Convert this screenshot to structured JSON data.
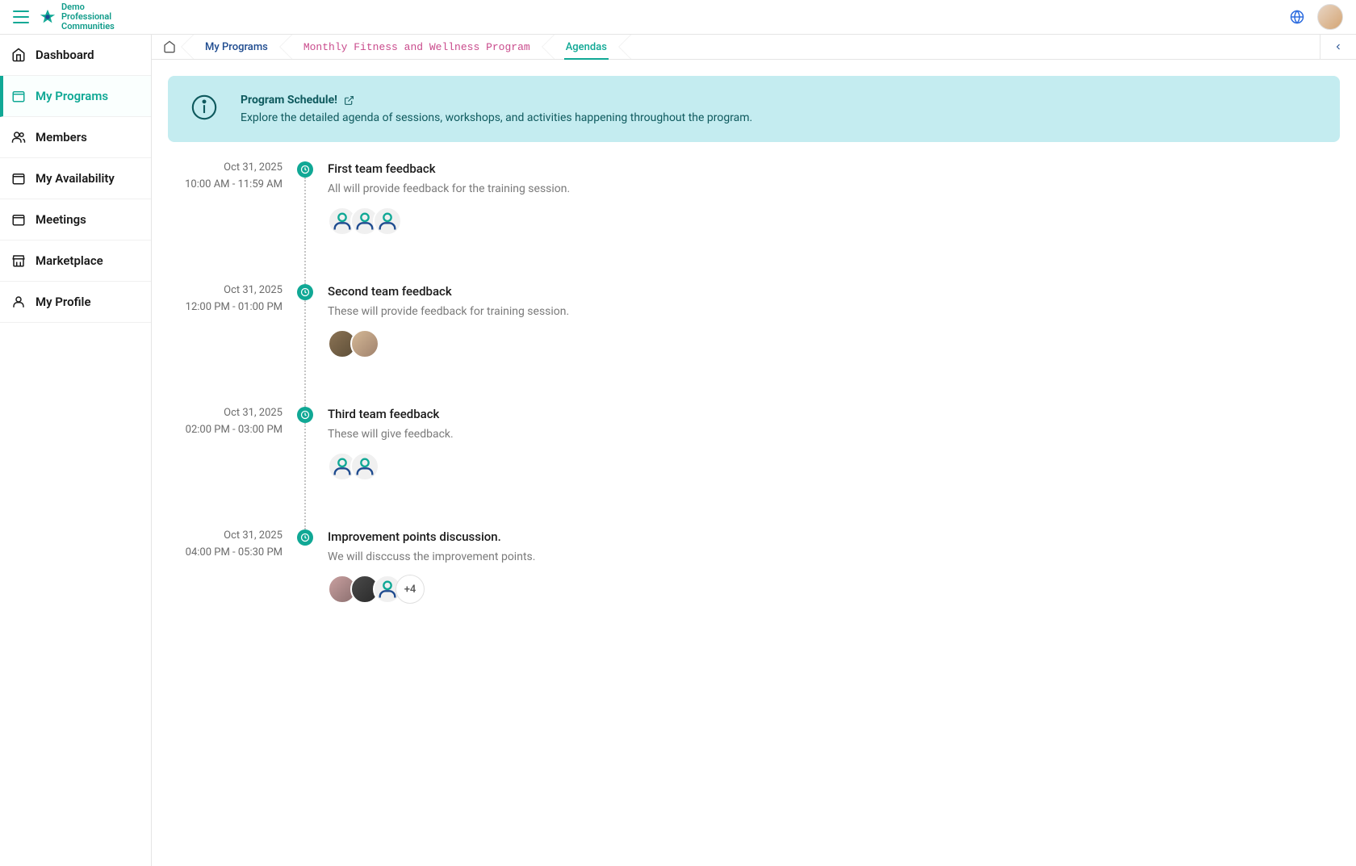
{
  "logo": {
    "line1": "Demo",
    "line2": "Professional",
    "line3": "Communities"
  },
  "sidebar": {
    "items": [
      {
        "label": "Dashboard"
      },
      {
        "label": "My Programs"
      },
      {
        "label": "Members"
      },
      {
        "label": "My Availability"
      },
      {
        "label": "Meetings"
      },
      {
        "label": "Marketplace"
      },
      {
        "label": "My Profile"
      }
    ]
  },
  "breadcrumb": {
    "items": [
      {
        "label": "My Programs"
      },
      {
        "label": "Monthly Fitness and Wellness Program"
      },
      {
        "label": "Agendas"
      }
    ]
  },
  "banner": {
    "title": "Program Schedule!",
    "desc": "Explore the detailed agenda of sessions, workshops, and activities happening throughout the program."
  },
  "agenda": [
    {
      "date": "Oct 31, 2025",
      "time": "10:00 AM - 11:59 AM",
      "title": "First team feedback",
      "desc": "All will provide feedback for the training session.",
      "attendees": [
        {
          "type": "ph"
        },
        {
          "type": "ph"
        },
        {
          "type": "ph"
        }
      ]
    },
    {
      "date": "Oct 31, 2025",
      "time": "12:00 PM - 01:00 PM",
      "title": "Second team feedback",
      "desc": "These will provide feedback for training session.",
      "attendees": [
        {
          "type": "photo1"
        },
        {
          "type": "photo2"
        }
      ]
    },
    {
      "date": "Oct 31, 2025",
      "time": "02:00 PM - 03:00 PM",
      "title": "Third team feedback",
      "desc": "These will give feedback.",
      "attendees": [
        {
          "type": "ph"
        },
        {
          "type": "ph"
        }
      ]
    },
    {
      "date": "Oct 31, 2025",
      "time": "04:00 PM - 05:30 PM",
      "title": "Improvement points discussion.",
      "desc": "We will disccuss the improvement points.",
      "attendees": [
        {
          "type": "photo3"
        },
        {
          "type": "photo4"
        },
        {
          "type": "ph"
        },
        {
          "type": "more",
          "label": "+4"
        }
      ]
    }
  ]
}
